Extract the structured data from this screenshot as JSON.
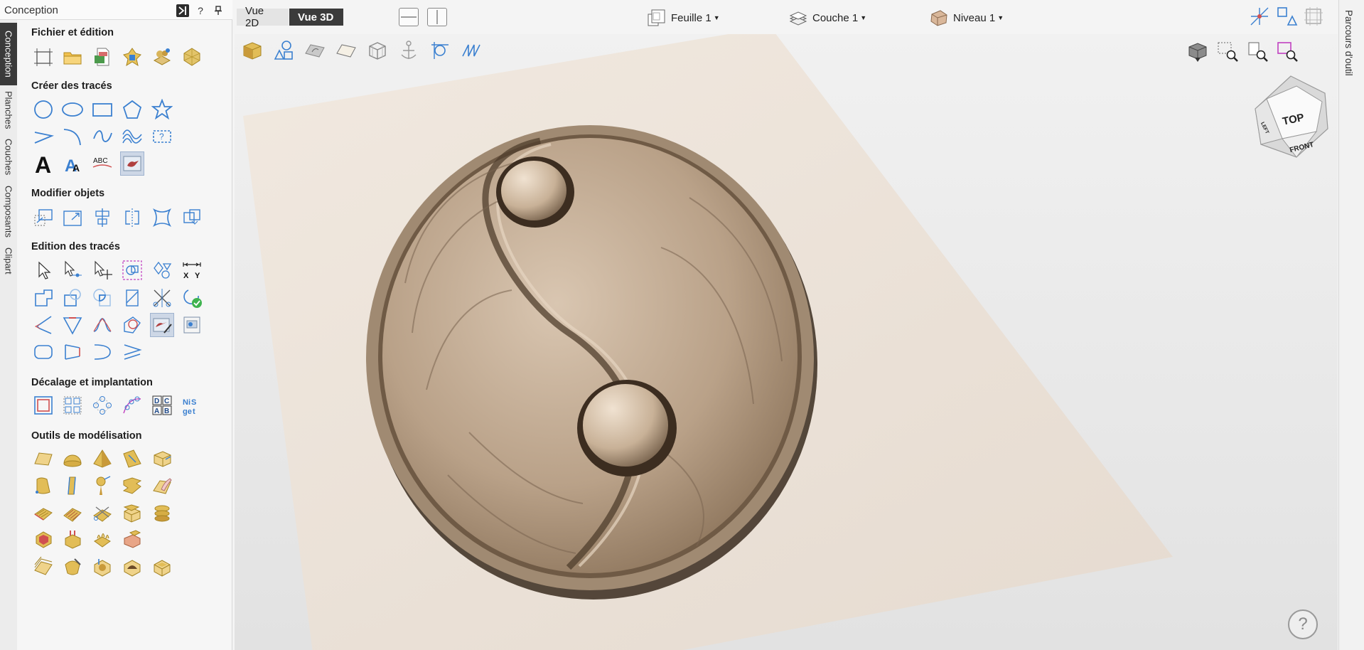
{
  "panel": {
    "title": "Conception",
    "help": "?",
    "vtabs": [
      "Conception",
      "Planches",
      "Couches",
      "Composants",
      "Clipart"
    ],
    "sections": {
      "file": "Fichier et édition",
      "create": "Créer des tracés",
      "modify": "Modifier objets",
      "edit": "Edition des tracés",
      "offset": "Décalage et implantation",
      "modeling": "Outils de modélisation"
    }
  },
  "topbar": {
    "view2d": "Vue 2D",
    "view3d": "Vue 3D",
    "sheet": "Feuille 1",
    "layer": "Couche 1",
    "level": "Niveau 1"
  },
  "right_tab": "Parcours d'outil",
  "viewcube": {
    "top": "TOP",
    "front": "FRONT",
    "left": "LEFT"
  },
  "viewport_help": "?",
  "colors": {
    "accent": "#3b80d0",
    "active_tab": "#3a3a3a",
    "relief": "#b39c84",
    "material": "#efe6dc"
  }
}
